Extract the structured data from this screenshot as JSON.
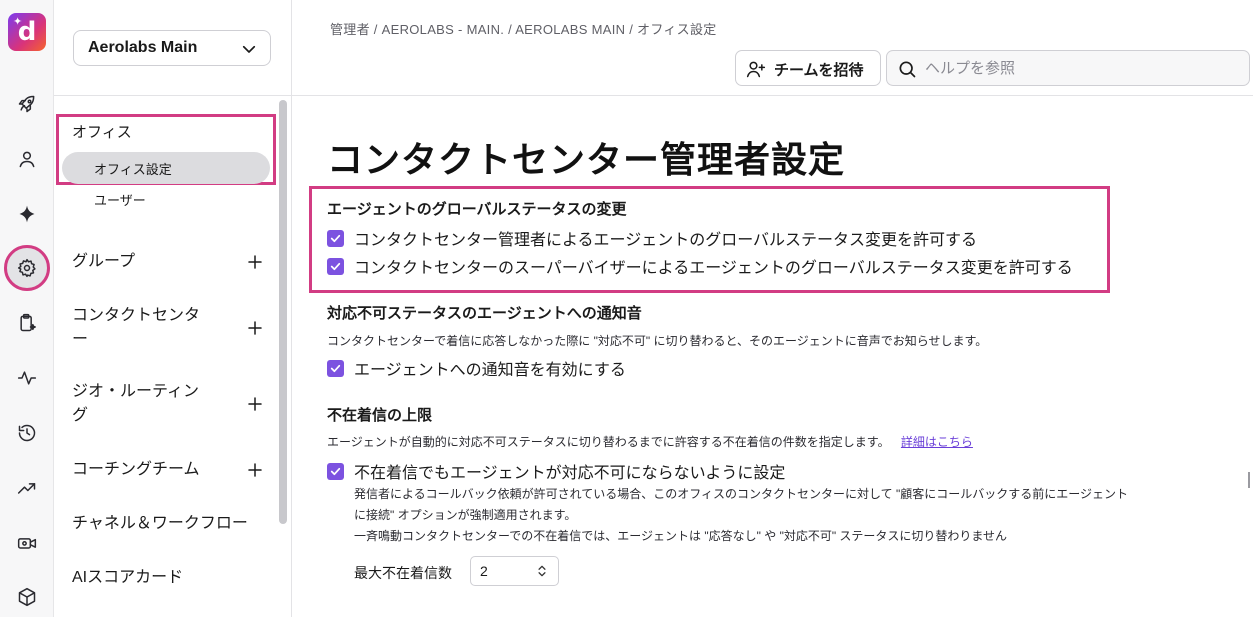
{
  "brand": {
    "logo_letter": "d",
    "accent": "#7c52e0",
    "highlight": "#d23c83"
  },
  "rail": {
    "icons": [
      "rocket-icon",
      "user-icon",
      "sparkle-icon",
      "gear-icon",
      "clipboard-sparkle-icon",
      "activity-icon",
      "history-icon",
      "trending-icon",
      "video-settings-icon",
      "cube-icon"
    ],
    "active": "gear-icon"
  },
  "workspace": {
    "selected": "Aerolabs Main"
  },
  "sidebar": {
    "office_section": "オフィス",
    "office_items": [
      "オフィス設定",
      "ユーザー"
    ],
    "groups": [
      {
        "label": "グループ",
        "expandable": true
      },
      {
        "label": "コンタクトセンター",
        "expandable": true
      },
      {
        "label": "ジオ・ルーティング",
        "expandable": true
      },
      {
        "label": "コーチングチーム",
        "expandable": true
      },
      {
        "label": "チャネル＆ワークフロー",
        "expandable": false
      },
      {
        "label": "AIスコアカード",
        "expandable": false
      }
    ]
  },
  "header": {
    "breadcrumb": "管理者 / AEROLABS - MAIN. / AEROLABS MAIN / オフィス設定",
    "invite_label": "チームを招待",
    "search_placeholder": "ヘルプを参照"
  },
  "main": {
    "title": "コンタクトセンター管理者設定",
    "global_status": {
      "title": "エージェントのグローバルステータスの変更",
      "options": [
        {
          "label": "コンタクトセンター管理者によるエージェントのグローバルステータス変更を許可する",
          "checked": true
        },
        {
          "label": "コンタクトセンターのスーパーバイザーによるエージェントのグローバルステータス変更を許可する",
          "checked": true
        }
      ]
    },
    "notify": {
      "title": "対応不可ステータスのエージェントへの通知音",
      "desc": "コンタクトセンターで着信に応答しなかった際に \"対応不可\" に切り替わると、そのエージェントに音声でお知らせします。",
      "option": {
        "label": "エージェントへの通知音を有効にする",
        "checked": true
      }
    },
    "missed": {
      "title": "不在着信の上限",
      "desc": "エージェントが自動的に対応不可ステータスに切り替わるまでに許容する不在着信の件数を指定します。",
      "link": "詳細はこちら",
      "option": {
        "label": "不在着信でもエージェントが対応不可にならないように設定",
        "checked": true
      },
      "sub1": "発信者によるコールバック依頼が許可されている場合、このオフィスのコンタクトセンターに対して \"顧客にコールバックする前にエージェント",
      "sub2": "に接続\" オプションが強制適用されます。",
      "sub3": "一斉鳴動コンタクトセンターでの不在着信では、エージェントは \"応答なし\" や \"対応不可\" ステータスに切り替わりません",
      "max_label": "最大不在着信数",
      "max_value": "2"
    }
  }
}
